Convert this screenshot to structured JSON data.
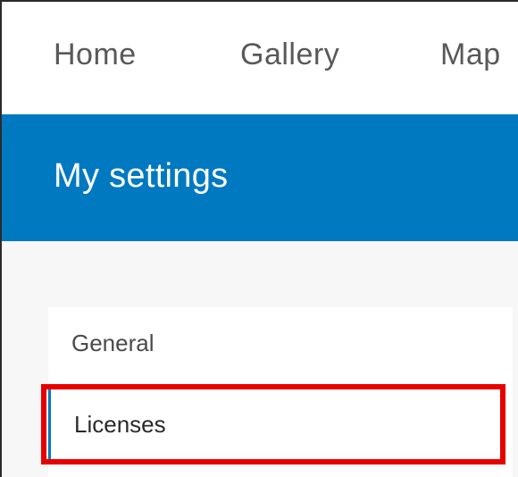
{
  "topnav": {
    "items": [
      {
        "label": "Home"
      },
      {
        "label": "Gallery"
      },
      {
        "label": "Map"
      }
    ]
  },
  "banner": {
    "title": "My settings"
  },
  "settings_menu": {
    "items": [
      {
        "label": "General"
      },
      {
        "label": "Licenses"
      }
    ]
  },
  "colors": {
    "banner_blue": "#0079c1",
    "highlight_red": "#e60000",
    "nav_text": "#595959"
  }
}
